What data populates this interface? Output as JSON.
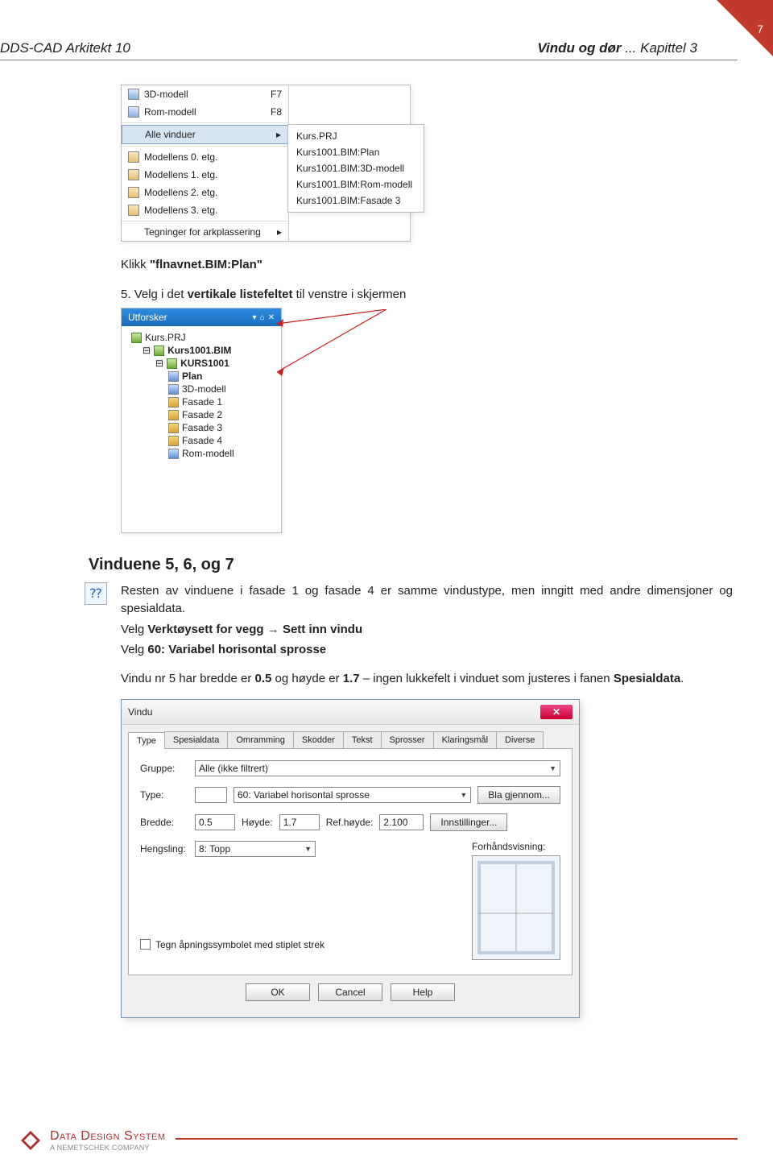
{
  "page_number": "7",
  "header": {
    "left": "DDS-CAD Arkitekt 10",
    "right_bold": "Vindu og dør",
    "right_rest": " ... Kapittel 3"
  },
  "menu": {
    "items": [
      {
        "label": "3D-modell",
        "shortcut": "F7"
      },
      {
        "label": "Rom-modell",
        "shortcut": "F8"
      },
      {
        "label": "Alle vinduer",
        "submenu_marker": "▸",
        "highlight": true
      },
      {
        "label": "Modellens 0. etg."
      },
      {
        "label": "Modellens 1. etg."
      },
      {
        "label": "Modellens 2. etg."
      },
      {
        "label": "Modellens 3. etg."
      },
      {
        "label": "Tegninger for arkplassering",
        "submenu_marker": "▸"
      }
    ],
    "flyout": [
      "Kurs.PRJ",
      "Kurs1001.BIM:Plan",
      "Kurs1001.BIM:3D-modell",
      "Kurs1001.BIM:Rom-modell",
      "Kurs1001.BIM:Fasade 3"
    ]
  },
  "text_block1": {
    "line1_pre": "Klikk  ",
    "line1_bold": "\"flnavnet.BIM:Plan\"",
    "line2_num": "5. ",
    "line2_pre": "Velg i det ",
    "line2_bold": "vertikale listefeltet",
    "line2_post": " til venstre i skjermen"
  },
  "explorer": {
    "title": "Utforsker",
    "tree": [
      {
        "level": 1,
        "label": "Kurs.PRJ",
        "icon": "green"
      },
      {
        "level": 2,
        "label": "Kurs1001.BIM",
        "bold": true,
        "icon": "green",
        "expander": "⊟"
      },
      {
        "level": 3,
        "label": "KURS1001",
        "bold": true,
        "icon": "green",
        "expander": "⊟"
      },
      {
        "level": 4,
        "label": "Plan",
        "bold": true,
        "icon": "blue"
      },
      {
        "level": 4,
        "label": "3D-modell",
        "icon": "blue"
      },
      {
        "level": 4,
        "label": "Fasade 1",
        "icon": ""
      },
      {
        "level": 4,
        "label": "Fasade 2",
        "icon": ""
      },
      {
        "level": 4,
        "label": "Fasade 3",
        "icon": ""
      },
      {
        "level": 4,
        "label": "Fasade 4",
        "icon": ""
      },
      {
        "level": 4,
        "label": "Rom-modell",
        "icon": "blue"
      }
    ]
  },
  "section2": {
    "heading": "Vinduene 5, 6, og 7",
    "p1": "Resten av vinduene i fasade 1 og fasade 4 er samme vindustype, men inngitt med andre dimensjoner og spesialdata.",
    "p2_pre": "Velg ",
    "p2_b1": "Verktøysett for vegg",
    "p2_mid": "  →  ",
    "p2_b2": "Sett inn vindu",
    "p3_pre": "Velg ",
    "p3_b": "60: Variabel horisontal sprosse",
    "p4_a": "Vindu nr 5 har bredde er ",
    "p4_b": "0.5",
    "p4_c": " og høyde er ",
    "p4_d": "1.7",
    "p4_e": " – ingen lukkefelt i vinduet som justeres i fanen ",
    "p4_f": "Spesialdata",
    "p4_g": "."
  },
  "dialog": {
    "title": "Vindu",
    "tabs": [
      "Type",
      "Spesialdata",
      "Omramming",
      "Skodder",
      "Tekst",
      "Sprosser",
      "Klaringsmål",
      "Diverse"
    ],
    "group_label": "Gruppe:",
    "group_value": "Alle (ikke filtrert)",
    "type_label": "Type:",
    "type_value": "60:  Variabel horisontal sprosse",
    "browse": "Bla gjennom...",
    "bredde_label": "Bredde:",
    "bredde_value": "0.5",
    "hoyde_label": "Høyde:",
    "hoyde_value": "1.7",
    "refh_label": "Ref.høyde:",
    "refh_value": "2.100",
    "settings": "Innstillinger...",
    "hengsling_label": "Hengsling:",
    "hengsling_value": "8: Topp",
    "preview_label": "Forhåndsvisning:",
    "checkbox_label": "Tegn åpningssymbolet med stiplet strek",
    "ok": "OK",
    "cancel": "Cancel",
    "help": "Help"
  },
  "footer": {
    "brand": "Data Design System",
    "sub": "A NEMETSCHEK COMPANY"
  }
}
